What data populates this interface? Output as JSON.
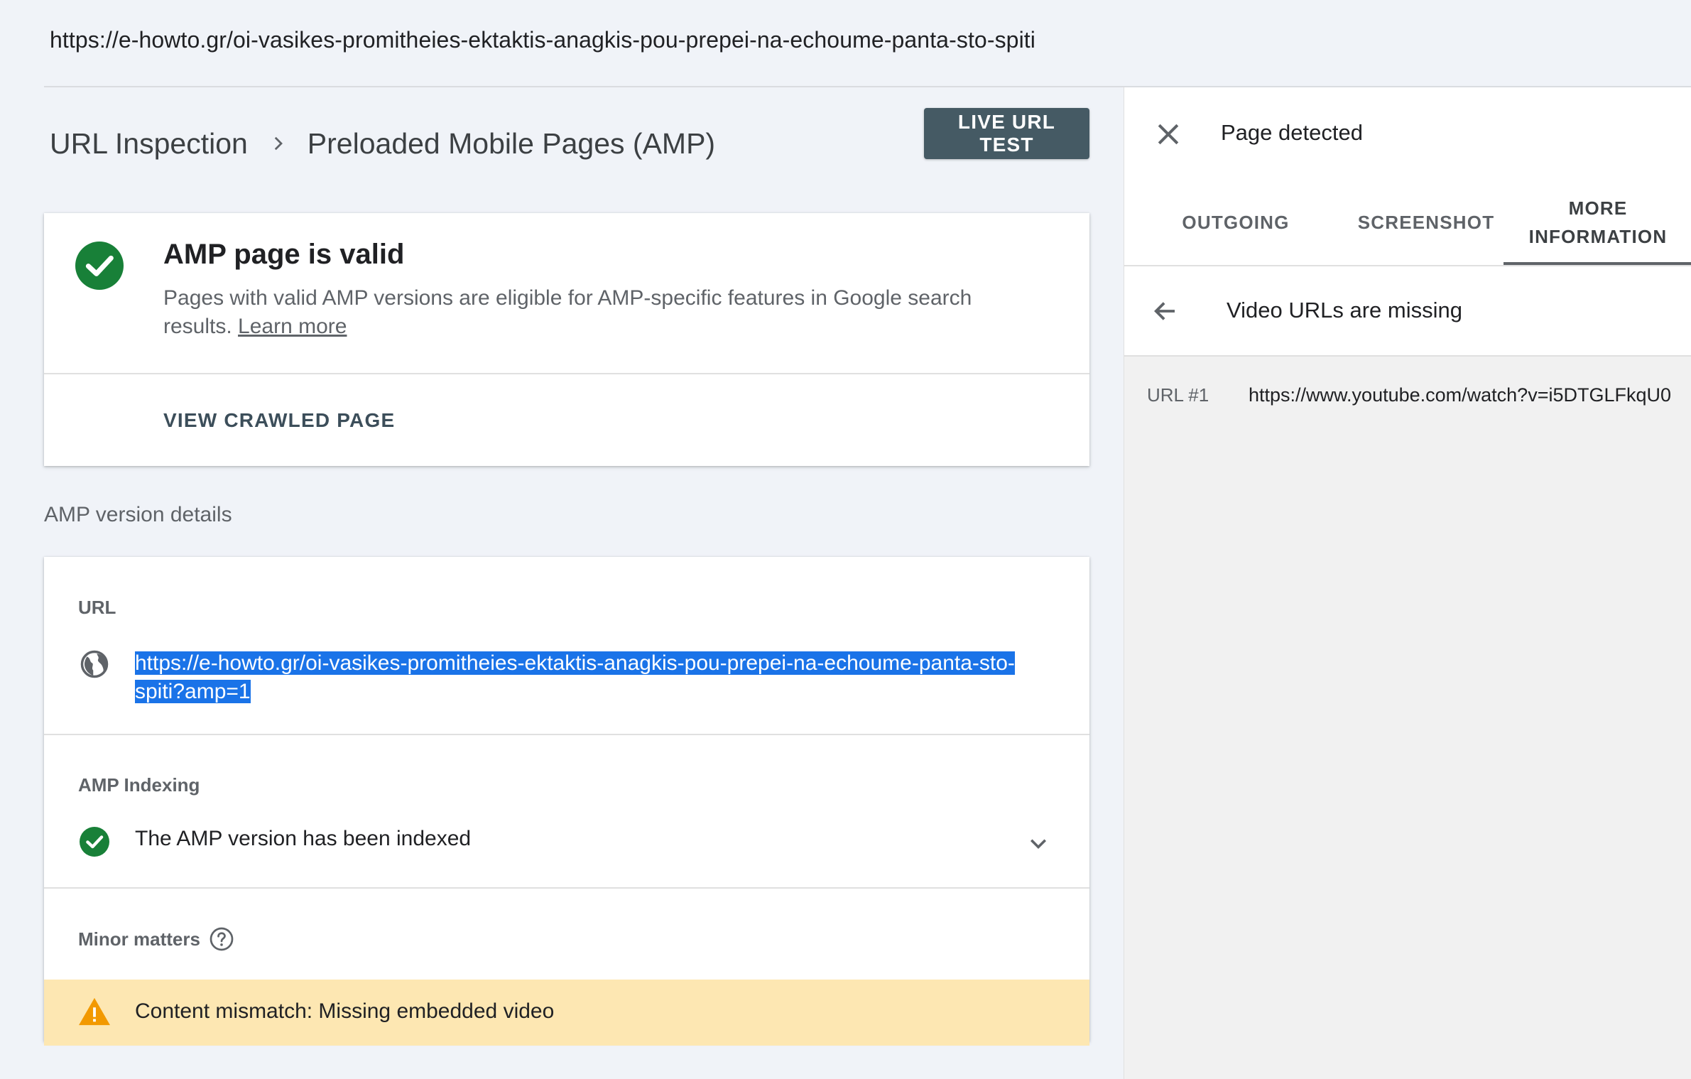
{
  "topbar": {
    "url": "https://e-howto.gr/oi-vasikes-promitheies-ektaktis-anagkis-pou-prepei-na-echoume-panta-sto-spiti"
  },
  "breadcrumb": {
    "root": "URL Inspection",
    "current": "Preloaded Mobile Pages (AMP)"
  },
  "toolbar": {
    "live_test_label": "LIVE URL TEST"
  },
  "status_card": {
    "title": "AMP page is valid",
    "description": "Pages with valid AMP versions are eligible for AMP-specific features in Google search results.",
    "learn_more": "Learn more",
    "view_crawled_label": "VIEW CRAWLED PAGE"
  },
  "details": {
    "section_label": "AMP version details",
    "url_label": "URL",
    "url_value": "https://e-howto.gr/oi-vasikes-promitheies-ektaktis-anagkis-pou-prepei-na-echoume-panta-sto-spiti?amp=1",
    "indexing_label": "AMP Indexing",
    "indexing_value": "The AMP version has been indexed",
    "minor_label": "Minor matters",
    "warning_text": "Content mismatch: Missing embedded video"
  },
  "panel": {
    "title": "Page detected",
    "tabs": [
      {
        "label": "OUTGOING"
      },
      {
        "label": "SCREENSHOT"
      },
      {
        "label_line1": "MORE",
        "label_line2": "INFORMATION"
      }
    ],
    "sub_title": "Video URLs are missing",
    "rows": [
      {
        "label": "URL #1",
        "value": "https://www.youtube.com/watch?v=i5DTGLFkqU0"
      }
    ]
  },
  "colors": {
    "accent_green": "#188038",
    "button_bg": "#455a64",
    "selection_blue": "#1a73e8",
    "warning_bg": "#fde7b2",
    "warning_icon": "#f29900"
  },
  "icons": {
    "status": "check-circle-icon",
    "globe": "globe-icon",
    "expand": "chevron-down-icon",
    "help": "help-circle-icon",
    "warning": "warning-triangle-icon",
    "close": "close-icon",
    "back": "arrow-back-icon"
  }
}
